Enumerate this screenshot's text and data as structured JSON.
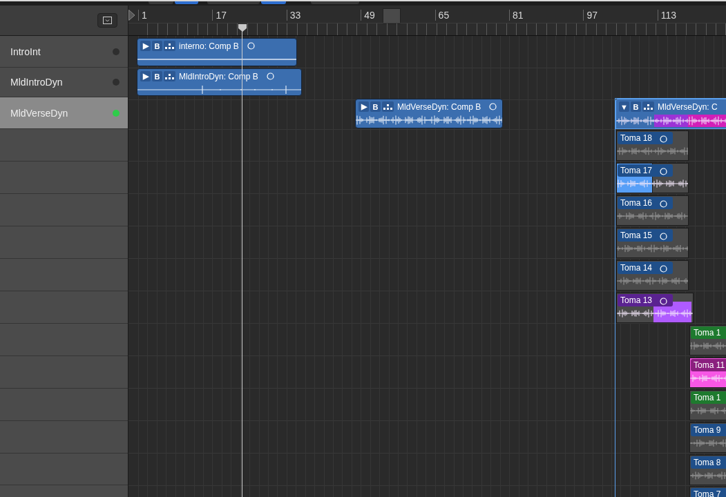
{
  "tracks": [
    {
      "name": "IntroInt",
      "selected": false,
      "color": "#2e2e2e"
    },
    {
      "name": "MldIntroDyn",
      "selected": false,
      "color": "#2e2e2e"
    },
    {
      "name": "MldVerseDyn",
      "selected": true,
      "color": "#2fcc4a"
    }
  ],
  "ruler": [
    "1",
    "17",
    "33",
    "49",
    "65",
    "81",
    "97",
    "113"
  ],
  "regions": [
    {
      "toggle": "▶",
      "badge": "B",
      "title": "interno: Comp B",
      "kind": "flat"
    },
    {
      "toggle": "▶",
      "badge": "B",
      "title": "MldIntroDyn: Comp B",
      "kind": "flat"
    },
    {
      "toggle": "▶",
      "badge": "B",
      "title": "MldVerseDyn: Comp B",
      "kind": "audio"
    },
    {
      "toggle": "▼",
      "badge": "B",
      "title": "MldVerseDyn: C",
      "kind": "folder",
      "segments": [
        {
          "color": "#3b6eaf"
        },
        {
          "color": "#9b33d6"
        },
        {
          "color": "#d21fb8"
        }
      ]
    }
  ],
  "takes": [
    {
      "name": "Toma 18",
      "color": "#1f4f8a",
      "kind": "plain"
    },
    {
      "name": "Toma 17",
      "color": "#1f4f8a",
      "kind": "left"
    },
    {
      "name": "Toma 16",
      "color": "#1f4f8a",
      "kind": "plain"
    },
    {
      "name": "Toma 15",
      "color": "#1f4f8a",
      "kind": "plain"
    },
    {
      "name": "Toma 14",
      "color": "#1f4f8a",
      "kind": "plain"
    },
    {
      "name": "Toma 13",
      "color": "#5a2290",
      "kind": "right"
    },
    {
      "name": "Toma 1",
      "color": "#1e7a2e",
      "kind": "plain"
    },
    {
      "name": "Toma 11",
      "color": "#8a1f7e",
      "kind": "full"
    },
    {
      "name": "Toma 1",
      "color": "#1e7a2e",
      "kind": "plain"
    },
    {
      "name": "Toma 9",
      "color": "#1f4f8a",
      "kind": "plain"
    },
    {
      "name": "Toma 8",
      "color": "#1f4f8a",
      "kind": "plain"
    },
    {
      "name": "Toma 7",
      "color": "#1f4f8a",
      "kind": "plain"
    }
  ]
}
